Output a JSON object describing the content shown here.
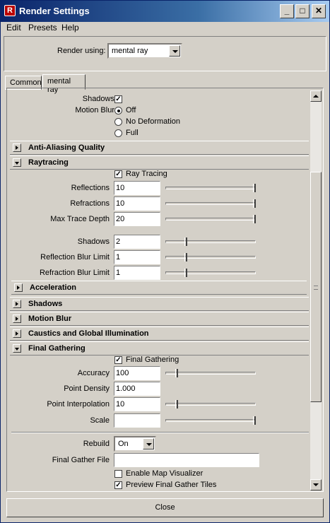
{
  "window": {
    "title": "Render Settings",
    "minimize": "_",
    "maximize": "□",
    "close": "✕"
  },
  "menu": [
    "Edit",
    "Presets",
    "Help"
  ],
  "render_using": {
    "label": "Render using:",
    "value": "mental ray"
  },
  "tabs": [
    "Common",
    "mental ray"
  ],
  "top_options": {
    "shadows_label": "Shadows",
    "shadows_checked": true,
    "motion_blur_label": "Motion Blur",
    "motion_blur_options": [
      "Off",
      "No Deformation",
      "Full"
    ],
    "motion_blur_selected": "Off"
  },
  "sections": {
    "anti_aliasing": "Anti-Aliasing Quality",
    "raytracing": "Raytracing",
    "acceleration": "Acceleration",
    "shadows": "Shadows",
    "motion_blur": "Motion Blur",
    "caustics": "Caustics and Global Illumination",
    "final_gathering": "Final Gathering"
  },
  "raytracing": {
    "toggle_label": "Ray Tracing",
    "toggle_checked": true,
    "reflections": {
      "label": "Reflections",
      "value": "10",
      "level": 1.0
    },
    "refractions": {
      "label": "Refractions",
      "value": "10",
      "level": 1.0
    },
    "max_trace_depth": {
      "label": "Max Trace Depth",
      "value": "20",
      "level": 1.0
    },
    "shadows": {
      "label": "Shadows",
      "value": "2",
      "level": 0.2
    },
    "reflection_blur_limit": {
      "label": "Reflection Blur Limit",
      "value": "1",
      "level": 0.2
    },
    "refraction_blur_limit": {
      "label": "Refraction Blur Limit",
      "value": "1",
      "level": 0.2
    }
  },
  "final_gathering": {
    "toggle_label": "Final Gathering",
    "toggle_checked": true,
    "accuracy": {
      "label": "Accuracy",
      "value": "100",
      "level": 0.1
    },
    "point_density": {
      "label": "Point Density",
      "value": "1.000"
    },
    "point_interpolation": {
      "label": "Point Interpolation",
      "value": "10",
      "level": 0.1
    },
    "scale": {
      "label": "Scale",
      "value": "",
      "level": 1.0
    },
    "rebuild": {
      "label": "Rebuild",
      "value": "On"
    },
    "final_gather_file": {
      "label": "Final Gather File",
      "value": ""
    },
    "enable_map_visualizer": {
      "label": "Enable Map Visualizer",
      "checked": false
    },
    "preview_tiles": {
      "label": "Preview Final Gather Tiles",
      "checked": true
    }
  },
  "close_button": "Close",
  "colors": {
    "titlebar": "#0a246a",
    "face": "#d4d0c8"
  },
  "icons": {
    "app": "render-settings-icon",
    "check": "✓"
  }
}
